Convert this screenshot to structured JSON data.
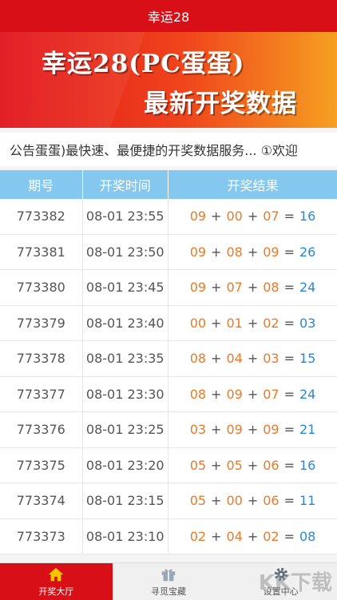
{
  "app_title": "幸运28",
  "banner": {
    "line1": "幸运28(PC蛋蛋)",
    "line2": "最新开奖数据"
  },
  "notice": "公告蛋蛋)最快速、最便捷的开奖数据服务... ①欢迎",
  "table": {
    "headers": [
      "期号",
      "开奖时间",
      "开奖结果"
    ],
    "rows": [
      {
        "id": "773382",
        "time": "08-01 23:55",
        "a": "09",
        "b": "00",
        "c": "07",
        "sum": "16"
      },
      {
        "id": "773381",
        "time": "08-01 23:50",
        "a": "09",
        "b": "08",
        "c": "09",
        "sum": "26"
      },
      {
        "id": "773380",
        "time": "08-01 23:45",
        "a": "09",
        "b": "07",
        "c": "08",
        "sum": "24"
      },
      {
        "id": "773379",
        "time": "08-01 23:40",
        "a": "00",
        "b": "01",
        "c": "02",
        "sum": "03"
      },
      {
        "id": "773378",
        "time": "08-01 23:35",
        "a": "08",
        "b": "04",
        "c": "03",
        "sum": "15"
      },
      {
        "id": "773377",
        "time": "08-01 23:30",
        "a": "08",
        "b": "09",
        "c": "07",
        "sum": "24"
      },
      {
        "id": "773376",
        "time": "08-01 23:25",
        "a": "03",
        "b": "09",
        "c": "09",
        "sum": "21"
      },
      {
        "id": "773375",
        "time": "08-01 23:20",
        "a": "05",
        "b": "05",
        "c": "06",
        "sum": "16"
      },
      {
        "id": "773374",
        "time": "08-01 23:15",
        "a": "05",
        "b": "00",
        "c": "06",
        "sum": "11"
      },
      {
        "id": "773373",
        "time": "08-01 23:10",
        "a": "02",
        "b": "04",
        "c": "02",
        "sum": "08"
      }
    ]
  },
  "tabs": [
    {
      "label": "开奖大厅",
      "icon": "home-icon",
      "active": true
    },
    {
      "label": "寻觅宝藏",
      "icon": "gift-icon",
      "active": false
    },
    {
      "label": "设置中心",
      "icon": "gear-icon",
      "active": false
    }
  ],
  "watermark": "KK下载",
  "colors": {
    "brand": "#d80f16",
    "header": "#84c8ef",
    "number": "#f07822",
    "sum": "#2b86d8"
  }
}
